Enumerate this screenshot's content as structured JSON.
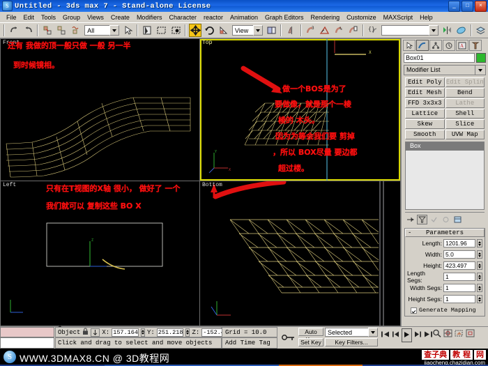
{
  "titlebar": {
    "text": "Untitled - 3ds max 7  - Stand-alone License",
    "icon": "max-logo-icon",
    "minimize": "_",
    "maximize": "□",
    "close": "×"
  },
  "menu": [
    "File",
    "Edit",
    "Tools",
    "Group",
    "Views",
    "Create",
    "Modifiers",
    "Character",
    "reactor",
    "Animation",
    "Graph Editors",
    "Rendering",
    "Customize",
    "MAXScript",
    "Help"
  ],
  "toolbar": {
    "selection_filter": "All",
    "reference_coord": "View",
    "named_selection_set": "",
    "icons": [
      "undo-icon",
      "redo-icon",
      "select-link-icon",
      "unlink-icon",
      "bind-space-warp-icon",
      "select-object-icon",
      "select-by-name-icon",
      "rectangular-select-icon",
      "window-crossing-icon",
      "select-and-move-icon",
      "select-and-rotate-icon",
      "select-and-scale-icon",
      "mirror-icon",
      "align-icon",
      "array-icon",
      "snap-toggle-icon",
      "angle-snap-icon",
      "percent-snap-icon",
      "spinner-snap-icon",
      "named-selection-icon",
      "curve-editor-icon",
      "schematic-view-icon",
      "material-editor-icon",
      "layer-manager-icon"
    ]
  },
  "viewports": [
    {
      "label": "Front",
      "selected": false,
      "annotations": [
        "还有 我做的顶一般只做 一般 另一半",
        "到时候镜相。"
      ]
    },
    {
      "label": "Top",
      "selected": true,
      "annotations": [
        "做一个BOS是为了",
        "要做像，就是那个一棱",
        "棱的 木头。",
        "因为为等会我们要  剪掉",
        "，所以 BOX尽量 要边都",
        "超过楼。"
      ]
    },
    {
      "label": "Left",
      "selected": false,
      "annotations": [
        "只有在T视图的X轴 很小，  做好了 一个",
        "我们就可以 复制这些 BO X"
      ]
    },
    {
      "label": "Bottom",
      "selected": false,
      "annotations": []
    }
  ],
  "command_panel": {
    "tabs": [
      "create-tab-icon",
      "modify-tab-icon",
      "hierarchy-tab-icon",
      "motion-tab-icon",
      "display-tab-icon",
      "utilities-tab-icon"
    ],
    "active_tab_index": 1,
    "object_name": "Box01",
    "object_color": "#2db82d",
    "modifier_list_label": "Modifier List",
    "modifier_buttons": [
      {
        "label": "Edit Poly",
        "dim": false
      },
      {
        "label": "Edit Splin",
        "dim": true
      },
      {
        "label": "Edit Mesh",
        "dim": false
      },
      {
        "label": "Bend",
        "dim": false
      },
      {
        "label": "FFD 3x3x3",
        "dim": false
      },
      {
        "label": "Lathe",
        "dim": true
      },
      {
        "label": "Lattice",
        "dim": false
      },
      {
        "label": "Shell",
        "dim": false
      },
      {
        "label": "Skew",
        "dim": false
      },
      {
        "label": "Slice",
        "dim": false
      },
      {
        "label": "Smooth",
        "dim": false
      },
      {
        "label": "UVW Map",
        "dim": false
      }
    ],
    "stack": [
      "Box"
    ],
    "stack_tools": [
      "pin-stack-icon",
      "show-end-result-icon",
      "make-unique-icon",
      "remove-modifier-icon",
      "configure-sets-icon"
    ],
    "rollout": {
      "title": "Parameters",
      "minus": "-",
      "params": [
        {
          "label": "Length:",
          "value": "1201.96"
        },
        {
          "label": "Width:",
          "value": "5.0"
        },
        {
          "label": "Height:",
          "value": "423.497"
        },
        {
          "label": "Length Segs:",
          "value": "1"
        },
        {
          "label": "Width Segs:",
          "value": "1"
        },
        {
          "label": "Height Segs:",
          "value": "1"
        }
      ],
      "checkbox_label": "Generate Mapping"
    }
  },
  "status": {
    "object_count": "1 Object :",
    "lock_icon": "lock-selection-icon",
    "absolute_icon": "absolute-mode-icon",
    "x_label": "X:",
    "x_value": "157.164",
    "y_label": "Y:",
    "y_value": "251.218",
    "z_label": "Z:",
    "z_value": "-152.498",
    "grid": "Grid = 10.0",
    "prompt": "Click and drag to select and move objects",
    "add_time_tag": "Add Time Tag",
    "key_icon": "key-mode-icon",
    "auto_key": "Auto Key",
    "set_key": "Set Key",
    "key_selected": "Selected",
    "key_filters": "Key Filters...",
    "playback_icons": [
      "go-to-start-icon",
      "previous-frame-icon",
      "play-animation-icon",
      "next-frame-icon",
      "go-to-end-icon"
    ],
    "nav_icons": [
      "zoom-icon",
      "zoom-all-icon",
      "zoom-extents-icon",
      "zoom-region-icon",
      "pan-icon",
      "arc-rotate-icon",
      "maximize-viewport-icon"
    ]
  },
  "watermark": {
    "logo_icon": "site-logo-icon",
    "text": "WWW.3DMAX8.CN @ 3D教程网",
    "boxes": [
      "查子典",
      "教 程",
      "网"
    ],
    "url": "jiaocheng.chazidian.com"
  }
}
